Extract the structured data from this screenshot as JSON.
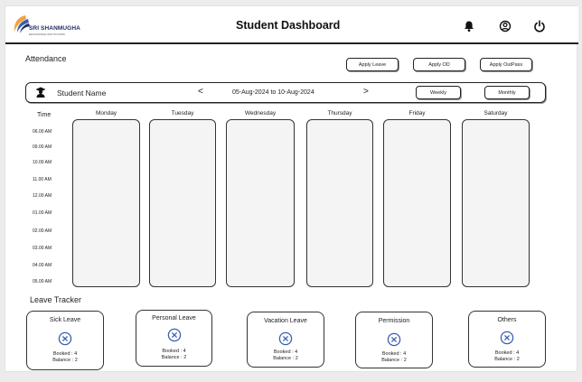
{
  "header": {
    "logo_text": "SRI SHANMUGHA",
    "logo_subtext": "EDUCATIONAL INSTITUTIONS",
    "title": "Student Dashboard",
    "icons": [
      "bell-icon",
      "user-circle-icon",
      "power-icon"
    ]
  },
  "attendance": {
    "title": "Attendance",
    "actions": {
      "apply_leave": "Apply Leave",
      "apply_od": "Apply OD",
      "apply_outpass": "Apply OutPass"
    },
    "student_name": "Student Name",
    "prev_arrow": "<",
    "next_arrow": ">",
    "date_from": "05-Aug-2024",
    "date_to_word": "to",
    "date_to": "10-Aug-2024",
    "view_weekly": "Weekly",
    "view_monthly": "Monthly",
    "time_header": "Time",
    "times": [
      "06.00 AM",
      "09.00 AM",
      "10.00 AM",
      "11.00 AM",
      "12.00 AM",
      "01.00 AM",
      "02.00 AM",
      "03.00 AM",
      "04.00 AM",
      "05.00 AM"
    ],
    "days": [
      "Monday",
      "Tuesday",
      "Wednesday",
      "Thursday",
      "Friday",
      "Saturday"
    ]
  },
  "leave_tracker": {
    "title": "Leave Tracker",
    "cards": [
      {
        "title": "Sick Leave",
        "booked": "Booked : 4",
        "balance": "Balance : 2"
      },
      {
        "title": "Personal Leave",
        "booked": "Booked : 4",
        "balance": "Balance : 2"
      },
      {
        "title": "Vacation Leave",
        "booked": "Booked : 4",
        "balance": "Balance : 2"
      },
      {
        "title": "Permission",
        "booked": "Booked : 4",
        "balance": "Balance : 2"
      },
      {
        "title": "Others",
        "booked": "Booked : 4",
        "balance": "Balance : 2"
      }
    ]
  },
  "colors": {
    "accent_blue": "#3a5fb0",
    "logo_orange": "#f2a33a",
    "logo_navy": "#1d2b5e"
  }
}
